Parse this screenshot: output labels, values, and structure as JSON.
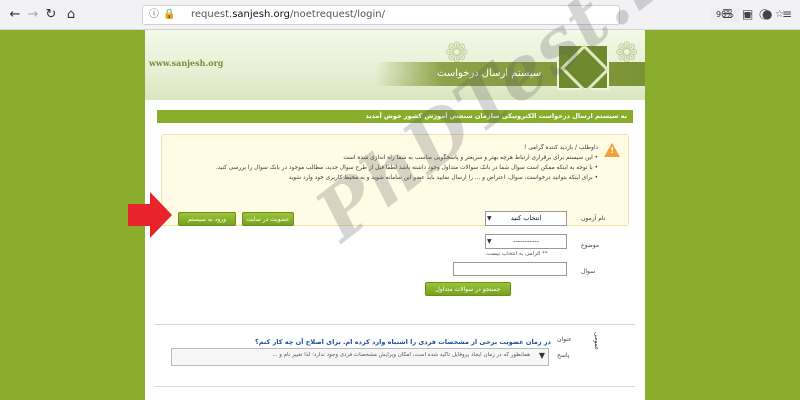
{
  "browser": {
    "url_prefix": "request.",
    "url_domain": "sanjesh.org",
    "url_path": "/noetrequest/login/",
    "zoom": "90%"
  },
  "banner": {
    "site_url": "www.sanjesh.org",
    "title": "سیستم ارسال درخواست"
  },
  "welcome_text": "به سیستم ارسال درخواست الکترونیکی سازمان سنجش آموزش کشور خوش آمدید",
  "alert": {
    "greeting": "داوطلب / بازدید کننده گرامی !",
    "lines": [
      "این سیستم برای برقراری ارتباط هرچه بهتر و سریعتر و پاسخگویی مناسب به شما راه اندازی شده است",
      "با توجه به اینکه ممکن است سوال شما در بانک سوالات متداول وجود داشته باشد لطفا قبل از طرح سوال جدید، مطالب موجود در بانک سوال را بررسی کنید.",
      "برای اینکه بتوانید درخواست، سوال، اعتراض و ... را ارسال نمایید باید عضو این سامانه شوید و به محیط کاربری خود وارد شوید"
    ]
  },
  "buttons": {
    "login": "ورود به سیستم",
    "register": "عضویت در سایت",
    "search_faq": "جستجو در سوالات متداول"
  },
  "form": {
    "exam_label": "نام آزمون",
    "exam_value": "انتخاب کنید",
    "topic_label": "موضوع",
    "topic_value": "-----------",
    "topic_hint": "** الزامی به انتخاب نیست.",
    "question_label": "سوال"
  },
  "faq": {
    "question": "در زمان عضویت برخی از مشخصات فردی را اشتباه وارد کرده ام. برای اصلاح آن چه کار کنم؟",
    "answer": "همانطور که در زمان ایجاد پروفایل تاکید شده است، امکان ویرایش مشخصات فردی وجود ندارد؛ لذا تغییر نام و ...",
    "side_label_1": "عنوان",
    "side_label_2": "پاسخ",
    "side_tab": "عمومی"
  },
  "watermark": "PhDTest.ir",
  "colors": {
    "page_bg": "#8aad2e",
    "accent_green": "#88ad2b",
    "alert_bg": "#fffbe5",
    "arrow_red": "#e8232a",
    "link_blue": "#1a4e9c"
  }
}
